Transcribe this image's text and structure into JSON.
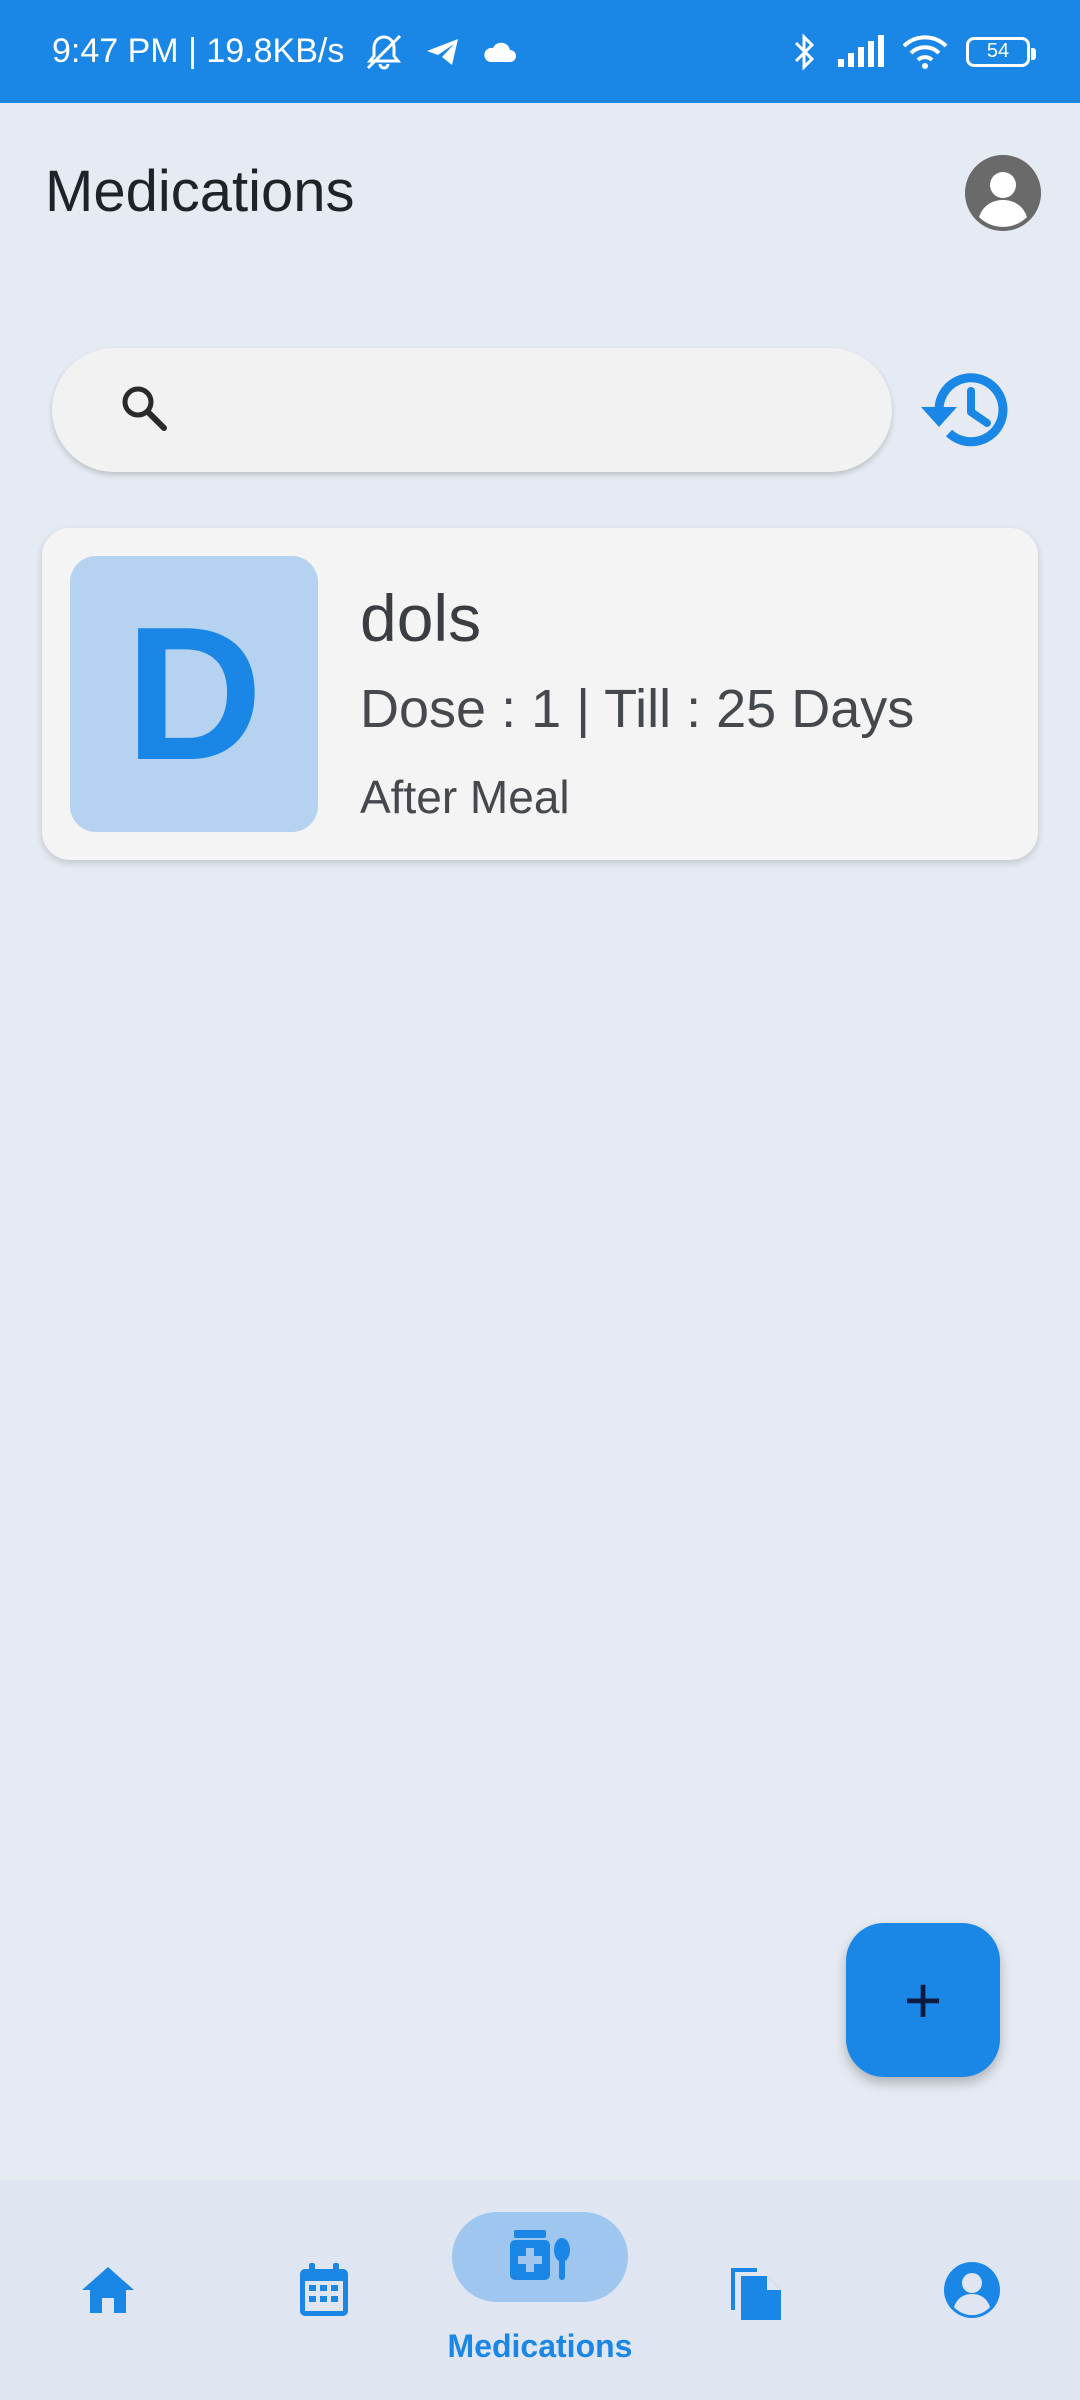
{
  "status_bar": {
    "time_speed": "9:47 PM | 19.8KB/s",
    "battery": "54"
  },
  "header": {
    "title": "Medications"
  },
  "search": {
    "placeholder": ""
  },
  "medications": [
    {
      "initial": "D",
      "name": "dols",
      "dose_line": "Dose : 1 | Till : 25 Days",
      "timing": "After Meal"
    }
  ],
  "fab": {
    "label": "+"
  },
  "bottom_nav": {
    "active_label": "Medications"
  },
  "colors": {
    "accent": "#1a87e6",
    "background": "#e6ebf3",
    "card": "#f4f4f5",
    "avatar_bg": "#b6d2f1"
  }
}
